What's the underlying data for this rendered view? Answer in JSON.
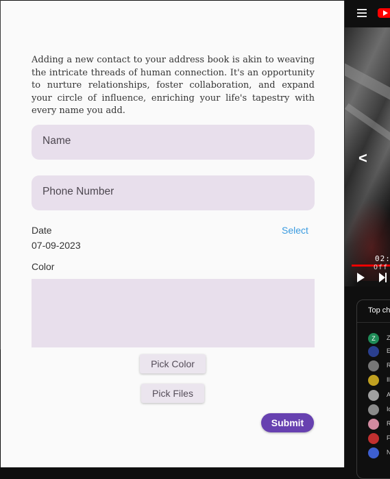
{
  "background_app": {
    "video": {
      "time_text": "02:",
      "subtitle_text": "Off",
      "prev_glyph": "<"
    },
    "chat": {
      "header": "Top ch",
      "rows": [
        {
          "avatar_letter": "Z",
          "avatar_color": "#1f8b57",
          "text": "Z"
        },
        {
          "avatar_letter": "",
          "avatar_color": "#2a3f8f",
          "text": "E"
        },
        {
          "avatar_letter": "",
          "avatar_color": "#777777",
          "text": "R"
        },
        {
          "avatar_letter": "",
          "avatar_color": "#c0a020",
          "text": "Il"
        },
        {
          "avatar_letter": "",
          "avatar_color": "#a0a0a0",
          "text": "A"
        },
        {
          "avatar_letter": "",
          "avatar_color": "#8a8a8a",
          "text": "Id"
        },
        {
          "avatar_letter": "",
          "avatar_color": "#d18aa0",
          "text": "R"
        },
        {
          "avatar_letter": "",
          "avatar_color": "#c03030",
          "text": "F"
        },
        {
          "avatar_letter": "",
          "avatar_color": "#3d5fd0",
          "text": "N"
        }
      ]
    }
  },
  "form": {
    "intro_text": "Adding a new contact to your address book is akin to weaving the intricate threads of human connection. It's an opportunity to nurture relationships, foster collaboration, and expand your circle of influence, enriching your life's tapestry with every name you add.",
    "name_placeholder": "Name",
    "phone_placeholder": "Phone Number",
    "date_label": "Date",
    "date_select_label": "Select",
    "date_value": "07-09-2023",
    "color_label": "Color",
    "selected_color": "#e8dfec",
    "pick_color_label": "Pick Color",
    "pick_files_label": "Pick Files",
    "submit_label": "Submit"
  },
  "colors": {
    "accent": "#6741b0",
    "link": "#3a9be0",
    "field_fill": "#e8dfec"
  }
}
